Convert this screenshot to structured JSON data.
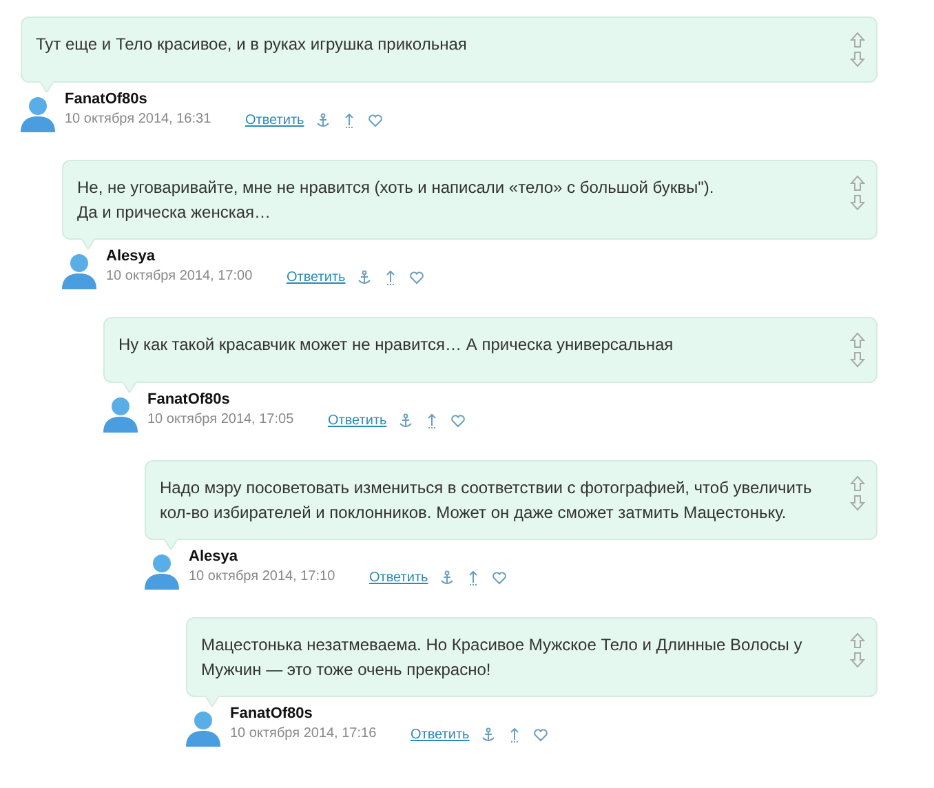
{
  "comments": [
    {
      "text": "Тут еще и Тело красивое, и в руках игрушка прикольная",
      "author": "FanatOf80s",
      "date": "10 октября 2014, 16:31",
      "reply": "Ответить",
      "children": [
        {
          "text": "Не, не уговаривайте, мне не нравится (хоть и написали «тело» с большой буквы\").\nДа и прическа женская…",
          "author": "Alesya",
          "date": "10 октября 2014, 17:00",
          "reply": "Ответить",
          "children": [
            {
              "text": "Ну как такой красавчик может не нравится… А прическа универсальная",
              "author": "FanatOf80s",
              "date": "10 октября 2014, 17:05",
              "reply": "Ответить",
              "children": [
                {
                  "text": "Надо мэру посоветовать измениться в соответствии с фотографией, чтоб увеличить\nкол-во избирателей и поклонников. Может он даже сможет затмить Мацестоньку.",
                  "author": "Alesya",
                  "date": "10 октября 2014, 17:10",
                  "reply": "Ответить",
                  "children": [
                    {
                      "text": "Мацестонька незатмеваема. Но Красивое Мужское Тело и Длинные Волосы у\nМужчин — это тоже очень прекрасно!",
                      "author": "FanatOf80s",
                      "date": "10 октября 2014, 17:16",
                      "reply": "Ответить"
                    }
                  ]
                }
              ]
            }
          ]
        }
      ]
    }
  ]
}
